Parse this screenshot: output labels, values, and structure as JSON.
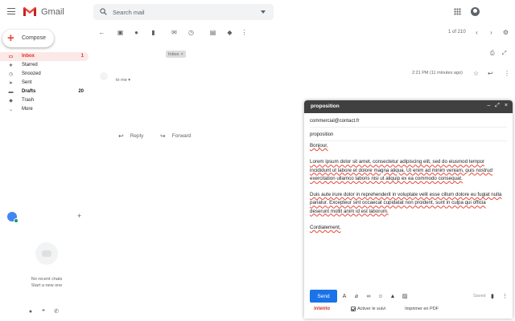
{
  "app": {
    "name": "Gmail"
  },
  "search": {
    "placeholder": "Search mail"
  },
  "compose_button": {
    "label": "Compose"
  },
  "nav": [
    {
      "label": "Inbox",
      "count": "1",
      "icon": "inbox-icon",
      "active": true
    },
    {
      "label": "Starred",
      "count": "",
      "icon": "star-icon"
    },
    {
      "label": "Snoozed",
      "count": "",
      "icon": "clock-icon"
    },
    {
      "label": "Sent",
      "count": "",
      "icon": "send-icon"
    },
    {
      "label": "Drafts",
      "count": "20",
      "icon": "draft-icon",
      "bold": true
    },
    {
      "label": "Trash",
      "count": "",
      "icon": "label-icon"
    },
    {
      "label": "More",
      "count": "",
      "icon": "chevron-down-icon"
    }
  ],
  "hangouts": {
    "no_chats": "No recent chats",
    "start_new": "Start a new one"
  },
  "pager": "1 of 210",
  "message": {
    "label_chip": "Inbox",
    "to": "to me",
    "time": "2:21 PM (11 minutes ago)",
    "reply": "Reply",
    "forward": "Forward"
  },
  "compose_window": {
    "title": "proposition",
    "to": "commercial@contact.fr",
    "subject": "proposition",
    "greeting": "Bonjour,",
    "para1": "Lorem ipsum dolor sit amet, consectetur adipiscing elit, sed do eiusmod tempor incididunt ut labore et dolore magna aliqua. Ut enim ad minim veniam, quis nostrud exercitation ullamco laboris nisi ut aliquip ex ea commodo consequat.",
    "para2": "Duis aute irure dolor in reprehenderit in voluptate velit esse cillum dolore eu fugiat nulla pariatur. Excepteur sint occaecat cupidatat non proident, sunt in culpa qui officia deserunt mollit anim id est laborum.",
    "signoff": "Cordialement,",
    "send": "Send",
    "saved": "Saved",
    "extension": {
      "logo": "intento",
      "activate_label": "Activer le suivi",
      "activate_checked": true,
      "pdf_label": "Imprimer en PDF"
    }
  },
  "colors": {
    "accent": "#1a73e8",
    "brand_red": "#d93025",
    "compose_header": "#404040"
  }
}
